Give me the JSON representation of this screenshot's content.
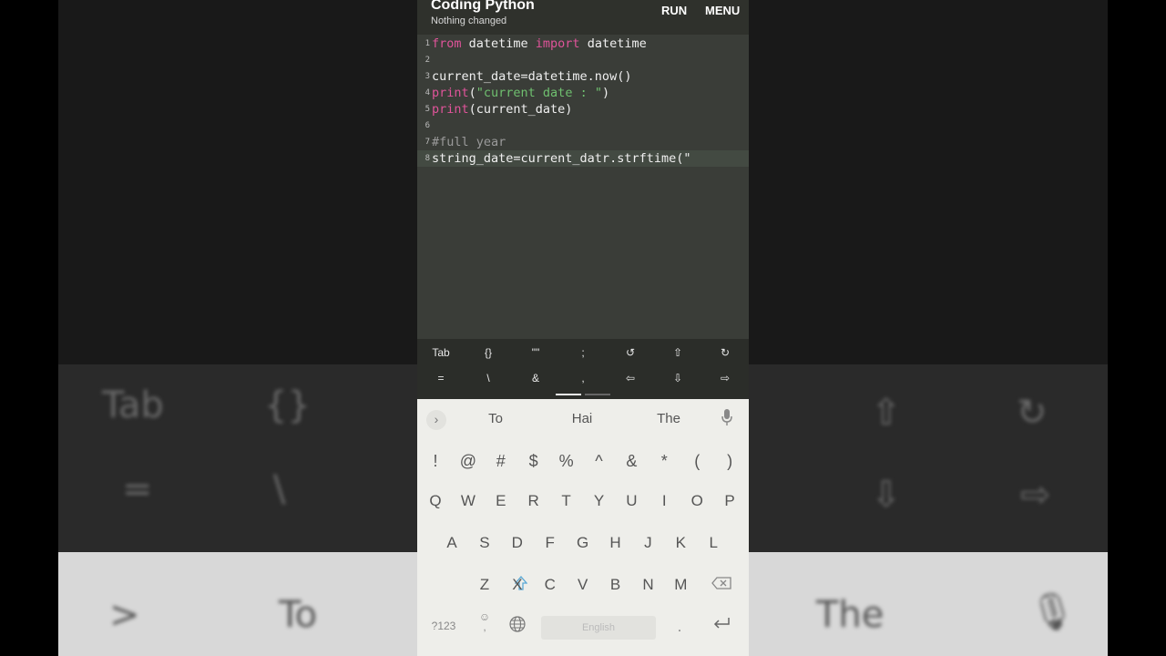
{
  "app": {
    "title": "Coding Python",
    "subtitle": "Nothing changed",
    "run_label": "RUN",
    "menu_label": "MENU"
  },
  "editor": {
    "lines": [
      {
        "num": "1",
        "parts": [
          [
            "kw",
            "from"
          ],
          [
            "txt",
            " datetime "
          ],
          [
            "kw",
            "import"
          ],
          [
            "txt",
            " datetime"
          ]
        ]
      },
      {
        "num": "2",
        "parts": []
      },
      {
        "num": "3",
        "parts": [
          [
            "txt",
            "current_date=datetime.now()"
          ]
        ]
      },
      {
        "num": "4",
        "parts": [
          [
            "kw",
            "print"
          ],
          [
            "txt",
            "("
          ],
          [
            "str",
            "\"current date : \""
          ],
          [
            "txt",
            ")"
          ]
        ]
      },
      {
        "num": "5",
        "parts": [
          [
            "kw",
            "print"
          ],
          [
            "txt",
            "(current_date)"
          ]
        ]
      },
      {
        "num": "6",
        "parts": []
      },
      {
        "num": "7",
        "parts": [
          [
            "cmt",
            "#full year"
          ]
        ]
      },
      {
        "num": "8",
        "parts": [
          [
            "txt",
            "string_date=current_datr.strftime(\""
          ]
        ]
      }
    ],
    "active_line": 8
  },
  "extra_keys": {
    "row1": [
      "Tab",
      "{}",
      "\"\"",
      ";",
      "↺",
      "⇧",
      "↻"
    ],
    "row2": [
      "=",
      "\\",
      "&",
      ",",
      "⇦",
      "⇩",
      "⇨"
    ]
  },
  "keyboard": {
    "suggestions": [
      "To",
      "Hai",
      "The"
    ],
    "symbols": [
      "!",
      "@",
      "#",
      "$",
      "%",
      "^",
      "&",
      "*",
      "(",
      ")"
    ],
    "row_q": [
      "Q",
      "W",
      "E",
      "R",
      "T",
      "Y",
      "U",
      "I",
      "O",
      "P"
    ],
    "row_a": [
      "A",
      "S",
      "D",
      "F",
      "G",
      "H",
      "J",
      "K",
      "L"
    ],
    "row_z": [
      "Z",
      "X",
      "C",
      "V",
      "B",
      "N",
      "M"
    ],
    "mode_label": "?123",
    "space_label": "English",
    "period": ".",
    "comma": ","
  },
  "background": {
    "left_top": [
      "Tab",
      "{}"
    ],
    "left_mid": [
      "=",
      "\\"
    ],
    "left_bottom": [
      ">",
      "To"
    ],
    "right_top": [
      "⇧",
      "↻"
    ],
    "right_mid": [
      "⇩",
      "⇨"
    ],
    "right_bottom": [
      "The"
    ]
  },
  "colors": {
    "keyword": "#e0549a",
    "string": "#6fbf6f",
    "comment": "#9a9a9a",
    "shift_accent": "#5aa9d6"
  }
}
